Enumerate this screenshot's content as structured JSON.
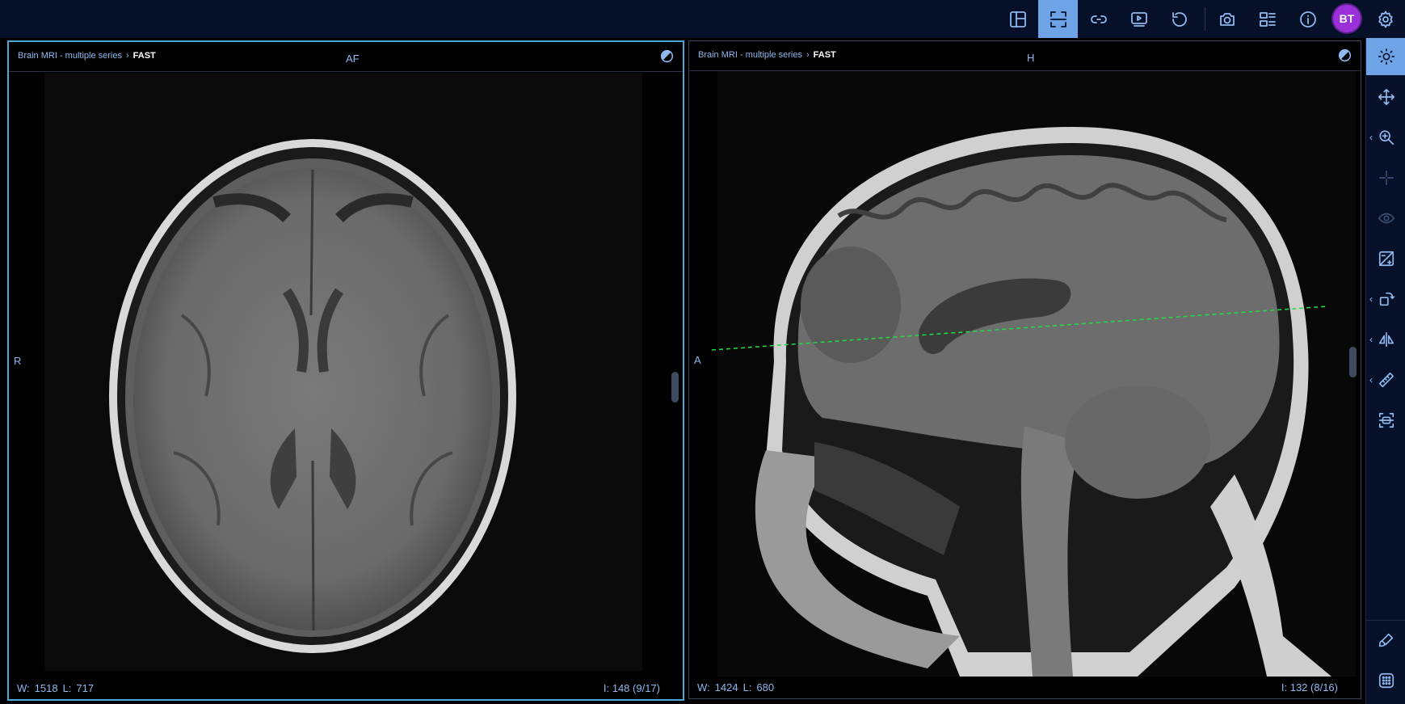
{
  "user": {
    "initials": "BT"
  },
  "toolbar": {
    "left_buttons": [
      "layout-icon",
      "fullscreen-frame-icon",
      "link-icon",
      "cine-icon",
      "reset-icon"
    ],
    "right_buttons": [
      "camera-icon",
      "series-list-icon",
      "info-icon",
      "gear-icon"
    ]
  },
  "viewports": [
    {
      "study": "Brain MRI - multiple series",
      "breadcrumb_sep": "›",
      "series": "FAST",
      "orientation_top": "AF",
      "orientation_left": "R",
      "window_label": "W:",
      "window": "1518",
      "level_label": "L:",
      "level": "717",
      "image_index": "I: 148 (9/17)",
      "active": true,
      "view": "axial"
    },
    {
      "study": "Brain MRI - multiple series",
      "breadcrumb_sep": "›",
      "series": "FAST",
      "orientation_top": "H",
      "orientation_left": "A",
      "window_label": "W:",
      "window": "1424",
      "level_label": "L:",
      "level": "680",
      "image_index": "I: 132 (8/16)",
      "active": false,
      "view": "sagittal",
      "reference_line_color": "#22dd44"
    }
  ],
  "tools": [
    {
      "icon": "sun-icon",
      "active": true
    },
    {
      "icon": "pan-icon"
    },
    {
      "icon": "zoom-icon",
      "has_menu": true
    },
    {
      "icon": "crosshair-icon",
      "disabled": true
    },
    {
      "icon": "eye-icon",
      "disabled": true
    },
    {
      "icon": "window-preset-icon"
    },
    {
      "icon": "rotate-icon",
      "has_menu": true
    },
    {
      "icon": "flip-icon",
      "has_menu": true
    },
    {
      "icon": "ruler-icon",
      "has_menu": true
    },
    {
      "icon": "scan-icon"
    },
    {
      "icon": "brush-icon"
    },
    {
      "icon": "pattern-icon"
    }
  ],
  "colors": {
    "background": "#061129",
    "accent": "#6ea3e6",
    "active_border": "#4aa8d8",
    "avatar": "#9b30d9"
  }
}
